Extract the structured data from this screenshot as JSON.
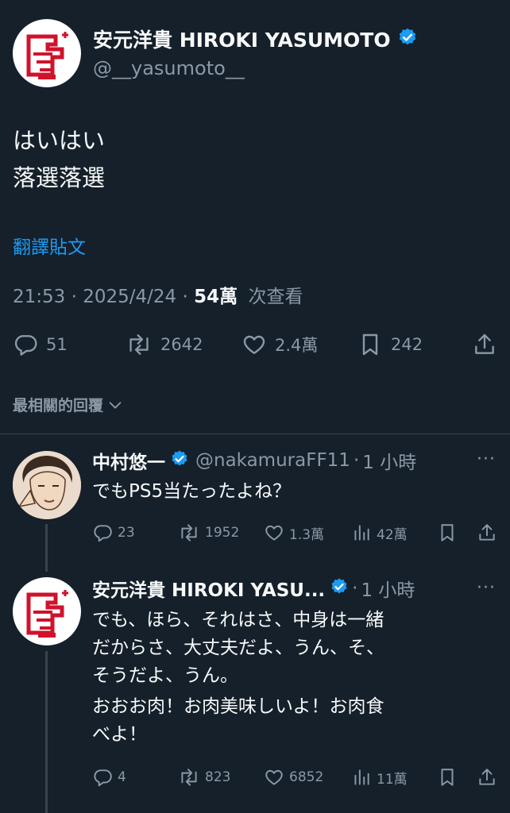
{
  "main_tweet": {
    "display_name": "安元洋貴 HIROKI YASUMOTO",
    "handle": "@__yasumoto__",
    "text_lines": [
      "はいはい",
      "落選落選"
    ],
    "translate_label": "翻譯貼文",
    "time": "21:53",
    "date": "2025/4/24",
    "views_count": "54萬",
    "views_label": "次查看",
    "replies": "51",
    "retweets": "2642",
    "likes": "2.4萬",
    "bookmarks": "242"
  },
  "sort_label": "最相關的回覆",
  "replies": [
    {
      "display_name": "中村悠一",
      "handle": "@nakamuraFF11",
      "time": "1 小時",
      "text": "でもPS5当たったよね？",
      "replies": "23",
      "retweets": "1952",
      "likes": "1.3萬",
      "views": "42萬"
    },
    {
      "display_name": "安元洋貴 HIROKI YASU...",
      "time": "1 小時",
      "text_lines": [
        "でも、ほら、それはさ、中身は一緒",
        "だからさ、大丈夫だよ、うん、そ、",
        "そうだよ、うん。",
        "おおお肉！お肉美味しいよ！お肉食",
        "べよ！"
      ],
      "replies": "4",
      "retweets": "823",
      "likes": "6852",
      "views": "11萬"
    }
  ],
  "more_glyph": "···",
  "colors": {
    "background": "#15202b",
    "text": "#f7f9f9",
    "muted": "#8b98a5",
    "link": "#1d9bf0",
    "verified": "#1d9bf0",
    "divider": "#38444d"
  },
  "icons": [
    "reply-icon",
    "retweet-icon",
    "like-icon",
    "bookmark-icon",
    "share-icon",
    "views-icon",
    "verified-badge-icon",
    "chevron-down-icon"
  ]
}
